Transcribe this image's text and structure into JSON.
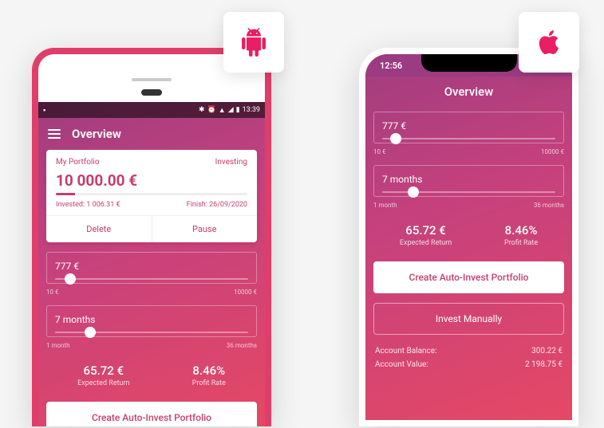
{
  "badges": {
    "android": "android-icon",
    "apple": "apple-icon"
  },
  "android": {
    "statusbar": {
      "time": "13:39"
    },
    "appbar": {
      "title": "Overview"
    },
    "portfolio": {
      "name": "My Portfolio",
      "status": "Investing",
      "amount": "10 000.00 €",
      "invested_label": "Invested: 1 006.31 €",
      "finish_label": "Finish: 26/09/2020",
      "delete": "Delete",
      "pause": "Pause"
    },
    "slider_amount": {
      "value": "777 €",
      "min": "10 €",
      "max": "10000 €"
    },
    "slider_months": {
      "value": "7 months",
      "min": "1 month",
      "max": "36 months"
    },
    "stats": {
      "expected_return": "65.72 €",
      "expected_return_label": "Expected Return",
      "profit_rate": "8.46%",
      "profit_rate_label": "Profit Rate"
    },
    "cta": "Create Auto-Invest Portfolio"
  },
  "iphone": {
    "statusbar": {
      "time": "12:56"
    },
    "title": "Overview",
    "slider_amount": {
      "value": "777 €",
      "min": "10 €",
      "max": "10000 €"
    },
    "slider_months": {
      "value": "7 months",
      "min": "1 month",
      "max": "36 months"
    },
    "stats": {
      "expected_return": "65.72 €",
      "expected_return_label": "Expected Return",
      "profit_rate": "8.46%",
      "profit_rate_label": "Profit Rate"
    },
    "cta": "Create Auto-Invest Portfolio",
    "manual": "Invest Manually",
    "account_balance_label": "Account Balance:",
    "account_balance": "300.22 €",
    "account_value_label": "Account Value:",
    "account_value": "2 198.75 €"
  }
}
